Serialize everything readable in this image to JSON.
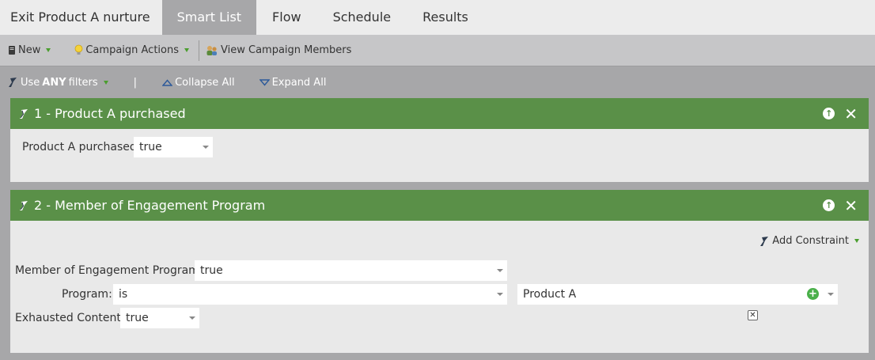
{
  "tabs": [
    {
      "label": "Exit Product A nurture",
      "active": false
    },
    {
      "label": "Smart List",
      "active": true
    },
    {
      "label": "Flow",
      "active": false
    },
    {
      "label": "Schedule",
      "active": false
    },
    {
      "label": "Results",
      "active": false
    }
  ],
  "toolbar": {
    "new_label": "New",
    "campaign_actions_label": "Campaign Actions",
    "view_members_label": "View Campaign Members"
  },
  "filterbar": {
    "use_label": "Use",
    "any_label": "ANY",
    "filters_label": "filters",
    "separator": "|",
    "collapse_label": "Collapse All",
    "expand_label": "Expand All"
  },
  "filters": [
    {
      "title": "1 - Product A purchased",
      "field_label": "Product A purchased",
      "value": "true"
    },
    {
      "title": "2 - Member of Engagement Program",
      "add_constraint_label": "Add Constraint",
      "rows": {
        "member_label": "Member of Engagement Program:",
        "member_value": "true",
        "program_label": "Program:",
        "program_operator": "is",
        "program_value": "Product A",
        "exhausted_label": "Exhausted Content:",
        "exhausted_value": "true"
      }
    }
  ],
  "colors": {
    "accent_green": "#5a9048",
    "tab_active_bg": "#a7a7a9",
    "toolbar_bg": "#c6c6c8"
  }
}
